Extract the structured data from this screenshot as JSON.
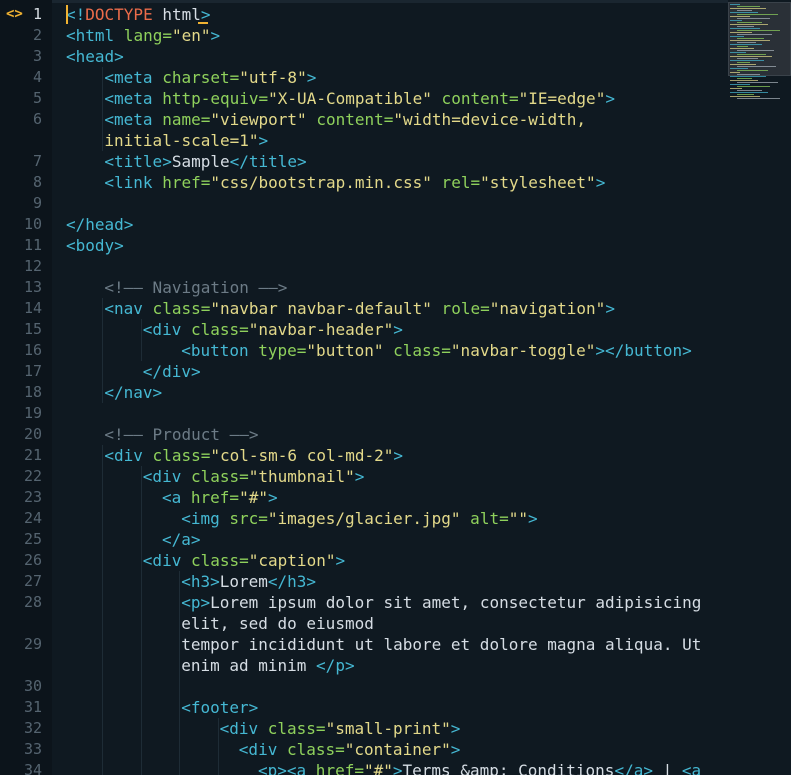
{
  "editor": {
    "gutter_icon": "<>",
    "line_numbers": [
      "1",
      "2",
      "3",
      "4",
      "5",
      "6",
      "",
      "7",
      "8",
      "9",
      "10",
      "11",
      "12",
      "13",
      "14",
      "15",
      "16",
      "17",
      "18",
      "19",
      "20",
      "21",
      "22",
      "23",
      "24",
      "25",
      "26",
      "27",
      "28",
      "",
      "29",
      "",
      "30",
      "31",
      "32",
      "33",
      "34"
    ],
    "lines": [
      [
        "<!",
        "DOCTYPE",
        " html",
        ">"
      ],
      [
        "<html",
        " lang=",
        "\"en\"",
        ">"
      ],
      [
        "<head>"
      ],
      [
        "<meta",
        " charset=",
        "\"utf-8\"",
        ">"
      ],
      [
        "<meta",
        " http-equiv=",
        "\"X-UA-Compatible\"",
        " content=",
        "\"IE=edge\"",
        ">"
      ],
      [
        "<meta",
        " name=",
        "\"viewport\"",
        " content=",
        "\"width=device-width,"
      ],
      [
        "initial-scale=1\"",
        ">"
      ],
      [
        "<title>",
        "Sample",
        "</title>"
      ],
      [
        "<link",
        " href=",
        "\"css/bootstrap.min.css\"",
        " rel=",
        "\"stylesheet\"",
        ">"
      ],
      [],
      [
        "</head>"
      ],
      [
        "<body>"
      ],
      [],
      [
        "<!—— Navigation ——>"
      ],
      [
        "<nav",
        " class=",
        "\"navbar navbar-default\"",
        " role=",
        "\"navigation\"",
        ">"
      ],
      [
        "<div",
        " class=",
        "\"navbar-header\"",
        ">"
      ],
      [
        "<button",
        " type=",
        "\"button\"",
        " class=",
        "\"navbar-toggle\"",
        "></button>"
      ],
      [
        "</div>"
      ],
      [
        "</nav>"
      ],
      [],
      [
        "<!—— Product ——>"
      ],
      [
        "<div",
        " class=",
        "\"col-sm-6 col-md-2\"",
        ">"
      ],
      [
        "<div",
        " class=",
        "\"thumbnail\"",
        ">"
      ],
      [
        "<a",
        " href=",
        "\"#\"",
        ">"
      ],
      [
        "<img",
        " src=",
        "\"images/glacier.jpg\"",
        " alt=",
        "\"\"",
        ">"
      ],
      [
        "</a>"
      ],
      [
        "<div",
        " class=",
        "\"caption\"",
        ">"
      ],
      [
        "<h3>",
        "Lorem",
        "</h3>"
      ],
      [
        "<p>",
        "Lorem ipsum dolor sit amet, consectetur adipisicing"
      ],
      [
        "elit, sed do eiusmod"
      ],
      [
        "tempor incididunt ut labore et dolore magna aliqua. Ut"
      ],
      [
        "enim ad minim ",
        "</p>"
      ],
      [],
      [
        "<footer>"
      ],
      [
        "<div",
        " class=",
        "\"small-print\"",
        ">"
      ],
      [
        "<div",
        " class=",
        "\"container\"",
        ">"
      ],
      [
        "<p>",
        "<a",
        " href=",
        "\"#\"",
        ">",
        "Terms &amp; Conditions",
        "</a>",
        " | ",
        "<a"
      ]
    ]
  },
  "minimap": {
    "visible": true
  },
  "colors": {
    "background": "#0f1921",
    "tag": "#45b8d3",
    "attribute": "#8fd15c",
    "string": "#e3d98a",
    "comment": "#6c7b86",
    "doctype": "#ec6c4a",
    "cursor": "#f0b232"
  }
}
